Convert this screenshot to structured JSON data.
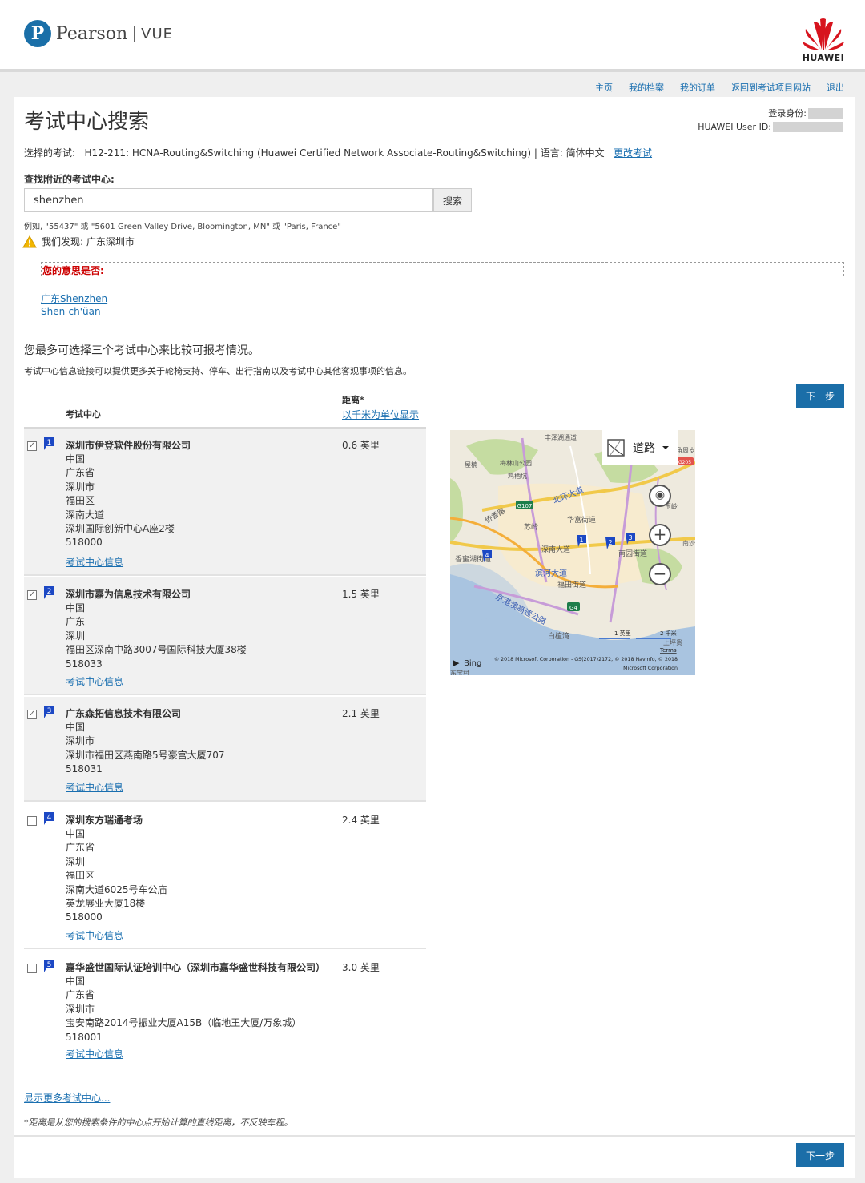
{
  "header": {
    "brand_initial": "P",
    "brand_name": "Pearson",
    "brand_product": "VUE",
    "partner_logo_text": "HUAWEI"
  },
  "nav": [
    "主页",
    "我的档案",
    "我的订单",
    "返回到考试项目网站",
    "退出"
  ],
  "page_title": "考试中心搜索",
  "identity": {
    "login_label": "登录身份:",
    "user_id_label": "HUAWEI User ID:"
  },
  "exam": {
    "prefix": "选择的考试:",
    "name": "H12-211: HCNA-Routing&Switching (Huawei Certified Network Associate-Routing&Switching)",
    "language": "| 语言: 简体中文",
    "change_link": "更改考试"
  },
  "search": {
    "label": "查找附近的考试中心:",
    "value": "shenzhen",
    "button": "搜索",
    "example": "例如,  \"55437\" 或 \"5601 Green Valley Drive, Bloomington, MN\" 或 \"Paris, France\"",
    "found": "我们发现: 广东深圳市"
  },
  "suggestions": {
    "title": "您的意思是否:",
    "items": [
      "广东Shenzhen",
      "Shen-ch'üan"
    ]
  },
  "compare_title": "您最多可选择三个考试中心来比较可报考情况。",
  "compare_note": "考试中心信息链接可以提供更多关于轮椅支持、停车、出行指南以及考试中心其他客观事项的信息。",
  "next_label": "下一步",
  "table": {
    "col_center": "考试中心",
    "col_distance": "距离*",
    "unit_link": "以千米为单位显示",
    "info_link": "考试中心信息",
    "rows": [
      {
        "num": "1",
        "checked": true,
        "name": "深圳市伊登软件股份有限公司",
        "distance": "0.6  英里",
        "address": [
          "中国",
          "广东省",
          "深圳市",
          "福田区",
          "深南大道",
          "深圳国际创新中心A座2楼",
          "518000"
        ]
      },
      {
        "num": "2",
        "checked": true,
        "name": "深圳市嘉为信息技术有限公司",
        "distance": "1.5  英里",
        "address": [
          "中国",
          "广东",
          "深圳",
          "福田区深南中路3007号国际科技大厦38楼",
          "518033"
        ]
      },
      {
        "num": "3",
        "checked": true,
        "name": "广东森拓信息技术有限公司",
        "distance": "2.1  英里",
        "address": [
          "中国",
          "深圳市",
          "深圳市福田区燕南路5号豪宫大厦707",
          "518031"
        ]
      },
      {
        "num": "4",
        "checked": false,
        "name": "深圳东方瑞通考场",
        "distance": "2.4  英里",
        "address": [
          "中国",
          "广东省",
          "深圳",
          "福田区",
          "深南大道6025号车公庙",
          "英龙展业大厦18楼",
          "518000"
        ]
      },
      {
        "num": "5",
        "checked": false,
        "name": "嘉华盛世国际认证培训中心（深圳市嘉华盛世科技有限公司）",
        "distance": "3.0  英里",
        "address": [
          "中国",
          "广东省",
          "深圳市",
          "宝安南路2014号振业大厦A15B（临地王大厦/万象城）",
          "518001"
        ]
      }
    ]
  },
  "map": {
    "type_label": "道路",
    "labels": [
      "丰泽湖通道",
      "梅林山公园",
      "鸡栖坑",
      "屋楠",
      "北环大道",
      "侨香路",
      "苏岭",
      "华富街道",
      "南园街道",
      "深南大道",
      "滨河大道",
      "福田街道",
      "香蜜湖街道",
      "京港澳高速公路",
      "白植湾",
      "角周岁",
      "玉岭",
      "南沙",
      "上坪贵",
      "东宝村",
      "G107",
      "G4",
      "G205"
    ],
    "scale_labels": [
      "1 英里",
      "2 千米"
    ],
    "terms": "Terms",
    "provider": "Bing",
    "copyright_1": "© 2018 Microsoft Corporation - GS(2017)2172, © 2018 NavInfo, © 2018",
    "copyright_2": "Microsoft Corporation",
    "pins": [
      "1",
      "2",
      "3",
      "4"
    ]
  },
  "more_link": "显示更多考试中心...",
  "footnote": "*距离是从您的搜索条件的中心点开始计算的直线距离，不反映车程。",
  "colors": {
    "link": "#1a6fb0",
    "button": "#1b6ea8",
    "alert": "#cc0000",
    "selected_row": "#f1f1f1",
    "huawei_red": "#d7141e",
    "flag": "#1c48c4"
  }
}
